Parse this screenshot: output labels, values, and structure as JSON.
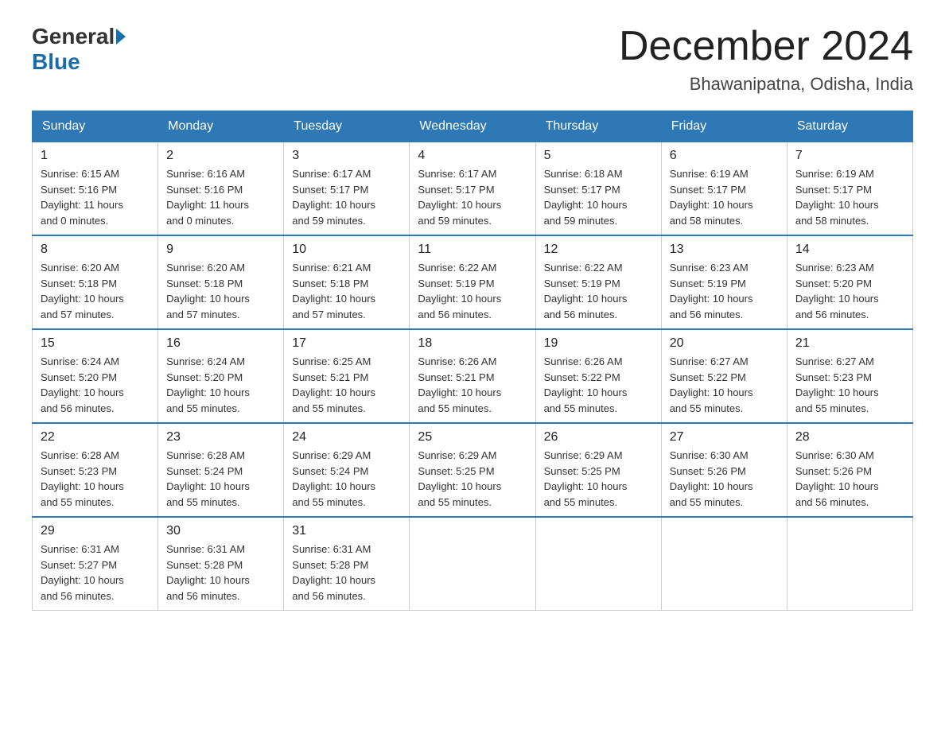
{
  "logo": {
    "general": "General",
    "blue": "Blue"
  },
  "header": {
    "month_year": "December 2024",
    "location": "Bhawanipatna, Odisha, India"
  },
  "days_of_week": [
    "Sunday",
    "Monday",
    "Tuesday",
    "Wednesday",
    "Thursday",
    "Friday",
    "Saturday"
  ],
  "weeks": [
    [
      {
        "day": "1",
        "sunrise": "6:15 AM",
        "sunset": "5:16 PM",
        "daylight": "11 hours and 0 minutes."
      },
      {
        "day": "2",
        "sunrise": "6:16 AM",
        "sunset": "5:16 PM",
        "daylight": "11 hours and 0 minutes."
      },
      {
        "day": "3",
        "sunrise": "6:17 AM",
        "sunset": "5:17 PM",
        "daylight": "10 hours and 59 minutes."
      },
      {
        "day": "4",
        "sunrise": "6:17 AM",
        "sunset": "5:17 PM",
        "daylight": "10 hours and 59 minutes."
      },
      {
        "day": "5",
        "sunrise": "6:18 AM",
        "sunset": "5:17 PM",
        "daylight": "10 hours and 59 minutes."
      },
      {
        "day": "6",
        "sunrise": "6:19 AM",
        "sunset": "5:17 PM",
        "daylight": "10 hours and 58 minutes."
      },
      {
        "day": "7",
        "sunrise": "6:19 AM",
        "sunset": "5:17 PM",
        "daylight": "10 hours and 58 minutes."
      }
    ],
    [
      {
        "day": "8",
        "sunrise": "6:20 AM",
        "sunset": "5:18 PM",
        "daylight": "10 hours and 57 minutes."
      },
      {
        "day": "9",
        "sunrise": "6:20 AM",
        "sunset": "5:18 PM",
        "daylight": "10 hours and 57 minutes."
      },
      {
        "day": "10",
        "sunrise": "6:21 AM",
        "sunset": "5:18 PM",
        "daylight": "10 hours and 57 minutes."
      },
      {
        "day": "11",
        "sunrise": "6:22 AM",
        "sunset": "5:19 PM",
        "daylight": "10 hours and 56 minutes."
      },
      {
        "day": "12",
        "sunrise": "6:22 AM",
        "sunset": "5:19 PM",
        "daylight": "10 hours and 56 minutes."
      },
      {
        "day": "13",
        "sunrise": "6:23 AM",
        "sunset": "5:19 PM",
        "daylight": "10 hours and 56 minutes."
      },
      {
        "day": "14",
        "sunrise": "6:23 AM",
        "sunset": "5:20 PM",
        "daylight": "10 hours and 56 minutes."
      }
    ],
    [
      {
        "day": "15",
        "sunrise": "6:24 AM",
        "sunset": "5:20 PM",
        "daylight": "10 hours and 56 minutes."
      },
      {
        "day": "16",
        "sunrise": "6:24 AM",
        "sunset": "5:20 PM",
        "daylight": "10 hours and 55 minutes."
      },
      {
        "day": "17",
        "sunrise": "6:25 AM",
        "sunset": "5:21 PM",
        "daylight": "10 hours and 55 minutes."
      },
      {
        "day": "18",
        "sunrise": "6:26 AM",
        "sunset": "5:21 PM",
        "daylight": "10 hours and 55 minutes."
      },
      {
        "day": "19",
        "sunrise": "6:26 AM",
        "sunset": "5:22 PM",
        "daylight": "10 hours and 55 minutes."
      },
      {
        "day": "20",
        "sunrise": "6:27 AM",
        "sunset": "5:22 PM",
        "daylight": "10 hours and 55 minutes."
      },
      {
        "day": "21",
        "sunrise": "6:27 AM",
        "sunset": "5:23 PM",
        "daylight": "10 hours and 55 minutes."
      }
    ],
    [
      {
        "day": "22",
        "sunrise": "6:28 AM",
        "sunset": "5:23 PM",
        "daylight": "10 hours and 55 minutes."
      },
      {
        "day": "23",
        "sunrise": "6:28 AM",
        "sunset": "5:24 PM",
        "daylight": "10 hours and 55 minutes."
      },
      {
        "day": "24",
        "sunrise": "6:29 AM",
        "sunset": "5:24 PM",
        "daylight": "10 hours and 55 minutes."
      },
      {
        "day": "25",
        "sunrise": "6:29 AM",
        "sunset": "5:25 PM",
        "daylight": "10 hours and 55 minutes."
      },
      {
        "day": "26",
        "sunrise": "6:29 AM",
        "sunset": "5:25 PM",
        "daylight": "10 hours and 55 minutes."
      },
      {
        "day": "27",
        "sunrise": "6:30 AM",
        "sunset": "5:26 PM",
        "daylight": "10 hours and 55 minutes."
      },
      {
        "day": "28",
        "sunrise": "6:30 AM",
        "sunset": "5:26 PM",
        "daylight": "10 hours and 56 minutes."
      }
    ],
    [
      {
        "day": "29",
        "sunrise": "6:31 AM",
        "sunset": "5:27 PM",
        "daylight": "10 hours and 56 minutes."
      },
      {
        "day": "30",
        "sunrise": "6:31 AM",
        "sunset": "5:28 PM",
        "daylight": "10 hours and 56 minutes."
      },
      {
        "day": "31",
        "sunrise": "6:31 AM",
        "sunset": "5:28 PM",
        "daylight": "10 hours and 56 minutes."
      },
      null,
      null,
      null,
      null
    ]
  ],
  "labels": {
    "sunrise": "Sunrise:",
    "sunset": "Sunset:",
    "daylight": "Daylight:"
  }
}
